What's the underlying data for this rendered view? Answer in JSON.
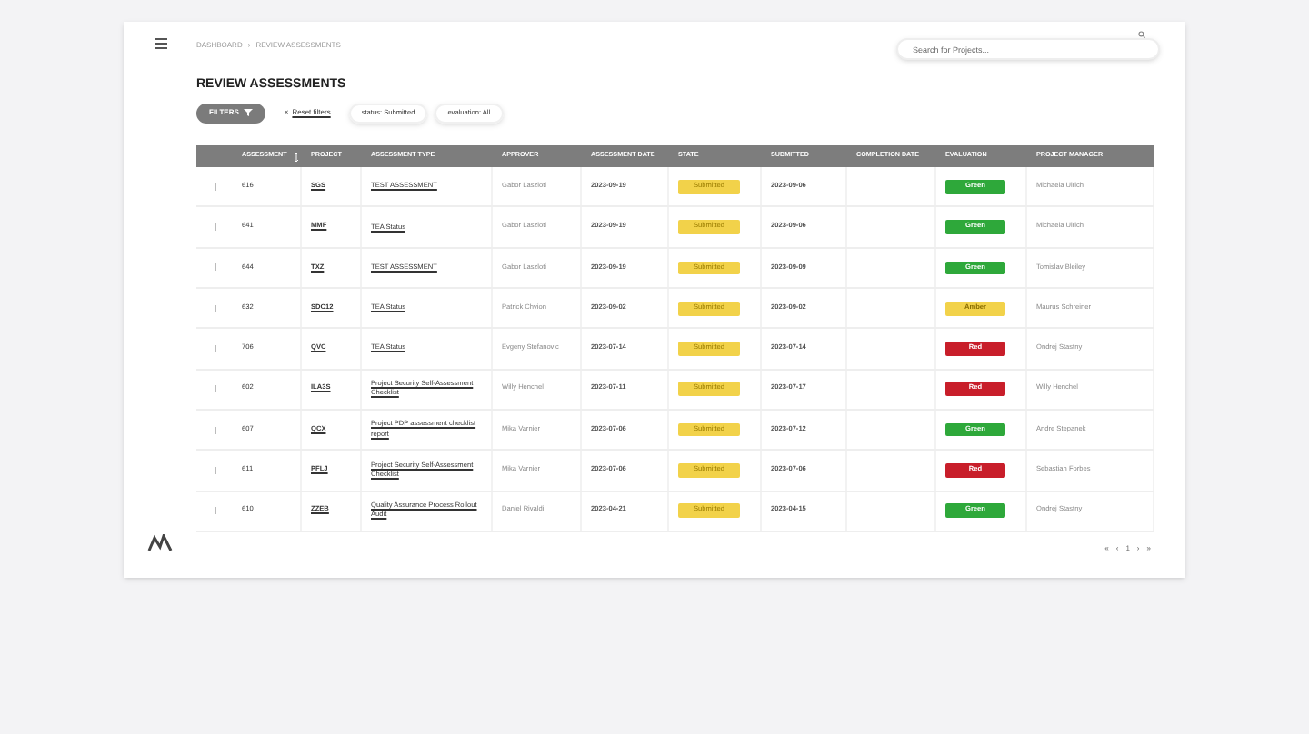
{
  "breadcrumb": [
    "DASHBOARD",
    "REVIEW ASSESSMENTS"
  ],
  "breadcrumb_separator": "›",
  "search": {
    "placeholder": "Search for Projects..."
  },
  "title": "REVIEW ASSESSMENTS",
  "filters": {
    "button": "FILTERS",
    "reset_icon": "×",
    "reset": "Reset filters",
    "chips": [
      "status: Submitted",
      "evaluation: All"
    ]
  },
  "table": {
    "columns": [
      "ASSESSMENT",
      "PROJECT",
      "ASSESSMENT TYPE",
      "APPROVER",
      "ASSESSMENT DATE",
      "STATE",
      "SUBMITTED",
      "COMPLETION DATE",
      "EVALUATION",
      "PROJECT MANAGER"
    ],
    "rows": [
      {
        "id": "616",
        "project": "SGS",
        "type": "TEST ASSESSMENT",
        "approver": "Gabor Laszloti",
        "date": "2023-09-19",
        "state": "Submitted",
        "submitted": "2023-09-06",
        "evaluation": "Green",
        "manager": "Michaela Ulrich"
      },
      {
        "id": "641",
        "project": "MMF",
        "type": "TEA Status",
        "approver": "Gabor Laszloti",
        "date": "2023-09-19",
        "state": "Submitted",
        "submitted": "2023-09-06",
        "evaluation": "Green",
        "manager": "Michaela Ulrich"
      },
      {
        "id": "644",
        "project": "TXZ",
        "type": "TEST ASSESSMENT",
        "approver": "Gabor Laszloti",
        "date": "2023-09-19",
        "state": "Submitted",
        "submitted": "2023-09-09",
        "evaluation": "Green",
        "manager": "Tomislav Bleiley"
      },
      {
        "id": "632",
        "project": "SDC12",
        "type": "TEA Status",
        "approver": "Patrick Chvion",
        "date": "2023-09-02",
        "state": "Submitted",
        "submitted": "2023-09-02",
        "evaluation": "Amber",
        "manager": "Maurus Schreiner"
      },
      {
        "id": "706",
        "project": "QVC",
        "type": "TEA Status",
        "approver": "Evgeny Stefanovic",
        "date": "2023-07-14",
        "state": "Submitted",
        "submitted": "2023-07-14",
        "evaluation": "Red",
        "manager": "Ondrej Stastny"
      },
      {
        "id": "602",
        "project": "ILA3S",
        "type": "Project Security Self-Assessment Checklist",
        "approver": "Willy Henchel",
        "date": "2023-07-11",
        "state": "Submitted",
        "submitted": "2023-07-17",
        "evaluation": "Red",
        "manager": "Willy Henchel"
      },
      {
        "id": "607",
        "project": "QCX",
        "type": "Project PDP assessment checklist report",
        "approver": "Mika Varnier",
        "date": "2023-07-06",
        "state": "Submitted",
        "submitted": "2023-07-12",
        "evaluation": "Green",
        "manager": "Andre Stepanek"
      },
      {
        "id": "611",
        "project": "PFLJ",
        "type": "Project Security Self-Assessment Checklist",
        "approver": "Mika Varnier",
        "date": "2023-07-06",
        "state": "Submitted",
        "submitted": "2023-07-06",
        "evaluation": "Red",
        "manager": "Sebastian Forbes"
      },
      {
        "id": "610",
        "project": "ZZEB",
        "type": "Quality Assurance Process Rollout Audit",
        "approver": "Daniel Rivaldi",
        "date": "2023-04-21",
        "state": "Submitted",
        "submitted": "2023-04-15",
        "evaluation": "Green",
        "manager": "Ondrej Stastny"
      }
    ]
  },
  "pagination": [
    "«",
    "‹",
    "1",
    "›",
    "»"
  ]
}
